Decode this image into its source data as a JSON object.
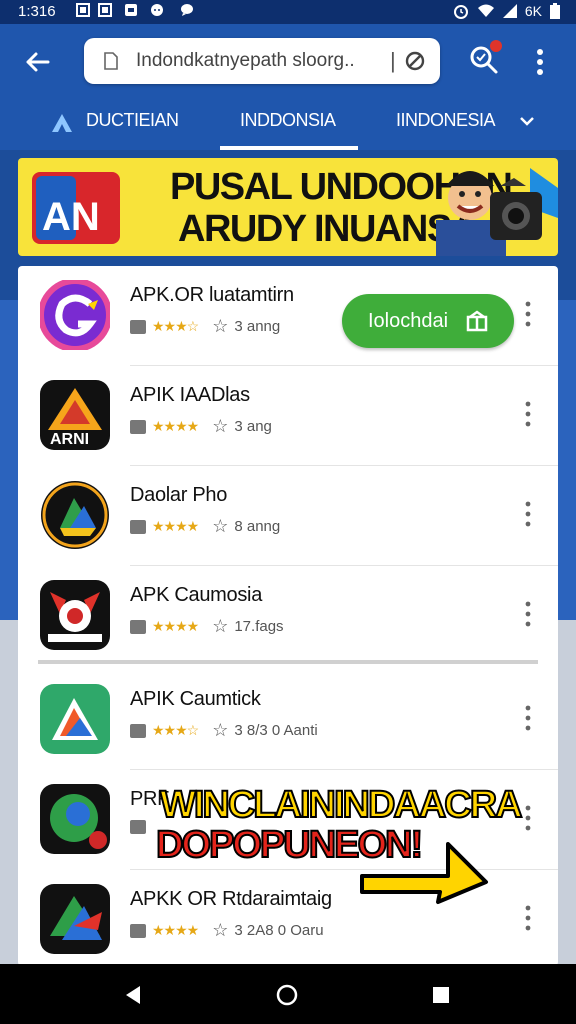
{
  "status_bar": {
    "time": "1:316",
    "battery": "6K"
  },
  "browser": {
    "url": "Indondkatnyepath sloorg..",
    "cursor": "|"
  },
  "tabs": [
    {
      "label": "DUCTIEIAN"
    },
    {
      "label": "INDDONSIA"
    },
    {
      "label": "IINDONESIA"
    }
  ],
  "banner": {
    "line1": "PUSAL UNDOOHAN",
    "line2": "ARUDY INUANSA",
    "logo_text": "AN"
  },
  "apps": [
    {
      "name": "APK.OR luatamtirn",
      "rating_text": "3 anng",
      "stars": 3.5
    },
    {
      "name": "APIK IAADlas",
      "rating_text": "3 ang",
      "stars": 4
    },
    {
      "name": "Daolar Pho",
      "rating_text": "8 anng",
      "stars": 4
    },
    {
      "name": "APK Caumosia",
      "rating_text": "17.fags",
      "stars": 4
    },
    {
      "name": "APIK Caumtick",
      "rating_text": "3 8/3 0 Aanti",
      "stars": 3.5
    },
    {
      "name": "PRF",
      "rating_text": "",
      "stars": 4
    },
    {
      "name": "APKK OR Rtdaraimtaig",
      "rating_text": "3 2A8 0 Oaru",
      "stars": 4
    }
  ],
  "download_button": {
    "label": "Iolochdai"
  },
  "promo": {
    "line1": "WINCLAININDAACRA",
    "line2": "DOPOPUNEON!"
  },
  "colors": {
    "appbar": "#1f56ad",
    "banner": "#f8e33a",
    "download": "#3fad3a",
    "star": "#e6a817"
  },
  "icons": [
    "back-arrow-icon",
    "file-icon",
    "clear-icon",
    "search-icon",
    "more-vert-icon",
    "chevron-down-icon",
    "star-icon",
    "gift-icon",
    "nav-back-icon",
    "nav-home-icon",
    "nav-recent-icon"
  ]
}
